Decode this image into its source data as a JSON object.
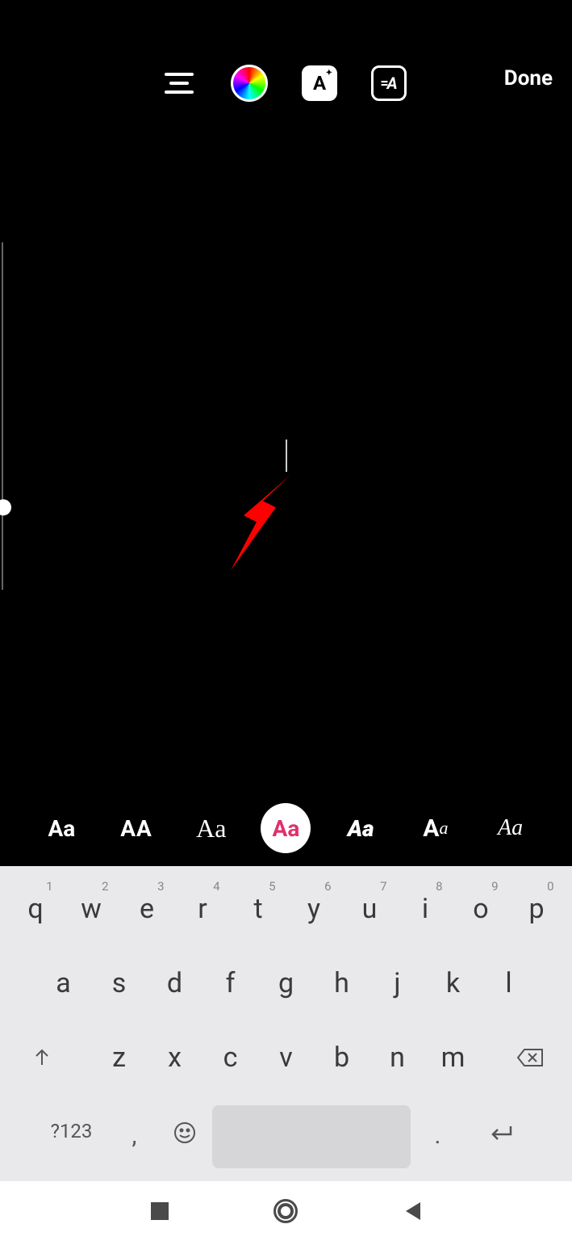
{
  "toolbar": {
    "done_label": "Done",
    "style_a_label": "A",
    "effect_label": "A"
  },
  "font_options": [
    {
      "label": "Aa"
    },
    {
      "label": "AA"
    },
    {
      "label": "Aa"
    },
    {
      "label": "Aa"
    },
    {
      "label": "Aa"
    },
    {
      "label": "Aa"
    },
    {
      "label": "Aa"
    }
  ],
  "keyboard": {
    "row1": [
      {
        "char": "q",
        "num": "1"
      },
      {
        "char": "w",
        "num": "2"
      },
      {
        "char": "e",
        "num": "3"
      },
      {
        "char": "r",
        "num": "4"
      },
      {
        "char": "t",
        "num": "5"
      },
      {
        "char": "y",
        "num": "6"
      },
      {
        "char": "u",
        "num": "7"
      },
      {
        "char": "i",
        "num": "8"
      },
      {
        "char": "o",
        "num": "9"
      },
      {
        "char": "p",
        "num": "0"
      }
    ],
    "row2": [
      {
        "char": "a"
      },
      {
        "char": "s"
      },
      {
        "char": "d"
      },
      {
        "char": "f"
      },
      {
        "char": "g"
      },
      {
        "char": "h"
      },
      {
        "char": "j"
      },
      {
        "char": "k"
      },
      {
        "char": "l"
      }
    ],
    "row3": [
      {
        "char": "z"
      },
      {
        "char": "x"
      },
      {
        "char": "c"
      },
      {
        "char": "v"
      },
      {
        "char": "b"
      },
      {
        "char": "n"
      },
      {
        "char": "m"
      }
    ],
    "symnum_label": "?123",
    "comma_label": ",",
    "period_label": "."
  }
}
